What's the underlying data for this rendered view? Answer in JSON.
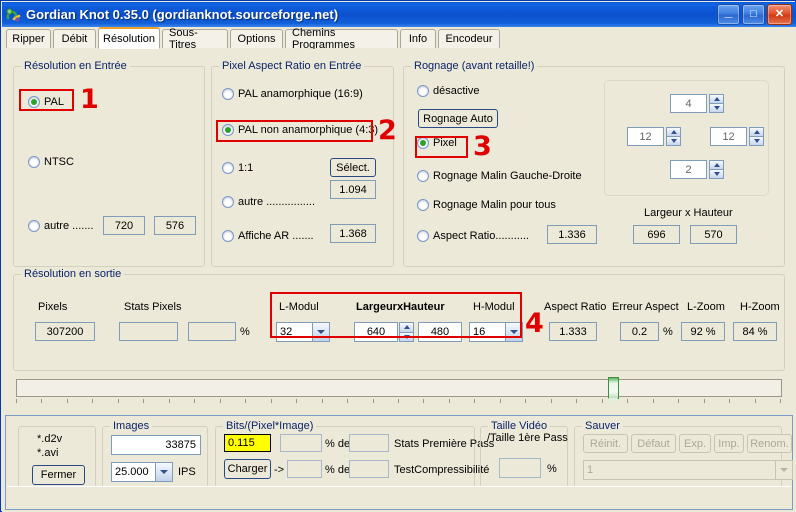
{
  "window": {
    "title": "Gordian Knot 0.35.0  (gordianknot.sourceforge.net)",
    "icon": "app-icon",
    "minimize_label": "_",
    "maximize_label": "□",
    "close_label": "✕"
  },
  "tabs": [
    {
      "label": "Ripper",
      "active": false
    },
    {
      "label": "Débit",
      "active": false
    },
    {
      "label": "Résolution",
      "active": true
    },
    {
      "label": "Sous-Titres",
      "active": false
    },
    {
      "label": "Options",
      "active": false
    },
    {
      "label": "Chemins Programmes",
      "active": false
    },
    {
      "label": "Info",
      "active": false
    },
    {
      "label": "Encodeur",
      "active": false
    }
  ],
  "input_resolution": {
    "legend": "Résolution en Entrée",
    "pal": "PAL",
    "ntsc": "NTSC",
    "autre": "autre .......",
    "width": "720",
    "height": "576",
    "annotation": "1"
  },
  "pixel_aspect_ratio": {
    "legend": "Pixel Aspect Ratio en Entrée",
    "pal_anamorphique": "PAL anamorphique (16:9)",
    "pal_non_anamorphique": "PAL non anamorphique (4:3)",
    "one_to_one": "1:1",
    "autre": "autre ................",
    "affiche_ar": "Affiche AR .......",
    "select_button": "Sélect.",
    "autre_value": "1.094",
    "affiche_ar_value": "1.368",
    "annotation": "2"
  },
  "rognage": {
    "legend": "Rognage (avant retaille!)",
    "desactive": "désactive",
    "rognage_auto_button": "Rognage Auto",
    "pixel": "Pixel",
    "malin_gauche_droite": "Rognage Malin Gauche-Droite",
    "malin_pour_tous": "Rognage Malin pour tous",
    "aspect_ratio": "Aspect Ratio...........",
    "aspect_ratio_value": "1.336",
    "crop_top": "4",
    "crop_left": "12",
    "crop_right": "12",
    "crop_bottom": "2",
    "largeur_hauteur_label": "Largeur x Hauteur",
    "largeur": "696",
    "hauteur": "570",
    "annotation": "3"
  },
  "output_resolution": {
    "legend": "Résolution en sortie",
    "pixels_label": "Pixels",
    "pixels_value": "307200",
    "stats_pixels_label": "Stats Pixels",
    "stats_pixels_value": "",
    "stats_pixels_pct_value": "",
    "percent_sign": "%",
    "l_modul_label": "L-Modul",
    "l_modul_value": "32",
    "largeur_hauteur_label": "LargeurxHauteur",
    "largeur_value": "640",
    "hauteur_value": "480",
    "h_modul_label": "H-Modul",
    "h_modul_value": "16",
    "aspect_ratio_label": "Aspect Ratio",
    "aspect_ratio_value": "1.333",
    "erreur_aspect_label": "Erreur Aspect",
    "erreur_aspect_value": "0.2",
    "erreur_aspect_unit": "%",
    "l_zoom_label": "L-Zoom",
    "l_zoom_value": "92 %",
    "h_zoom_label": "H-Zoom",
    "h_zoom_value": "84 %",
    "annotation": "4"
  },
  "slider": {
    "position_percent": 78
  },
  "bottom": {
    "files": {
      "d2v": "*.d2v",
      "avi": "*.avi",
      "close_button": "Fermer"
    },
    "images": {
      "legend": "Images",
      "frames": "33875",
      "fps": "25.000",
      "fps_unit": "IPS"
    },
    "bits": {
      "legend": "Bits/(Pixel*Image)",
      "value": "0.115",
      "pct1": "",
      "pct1_label": "% de",
      "val1": "",
      "row1_label": "Stats Première Pass",
      "charger_button": "Charger",
      "arrow": "->",
      "pct2": "",
      "pct2_label": "% de",
      "val2": "",
      "row2_label": "TestCompressibilité"
    },
    "taille_video": {
      "line1": "Taille Vidéo",
      "line2": "/Taille 1ère Pass",
      "value": "",
      "unit": "%"
    },
    "sauver": {
      "legend": "Sauver",
      "buttons": [
        "Réinit.",
        "Défaut",
        "Exp.",
        "Imp.",
        "Renom."
      ],
      "profile": "1"
    }
  },
  "colors": {
    "accent": "#0a246a",
    "annotation": "#e00000",
    "highlight": "#ffff00",
    "radio_dot": "#29a329",
    "dialog_bg": "#ece9d8",
    "titlebar": "#0c51cf",
    "active_tab_top": "#f0a030"
  }
}
